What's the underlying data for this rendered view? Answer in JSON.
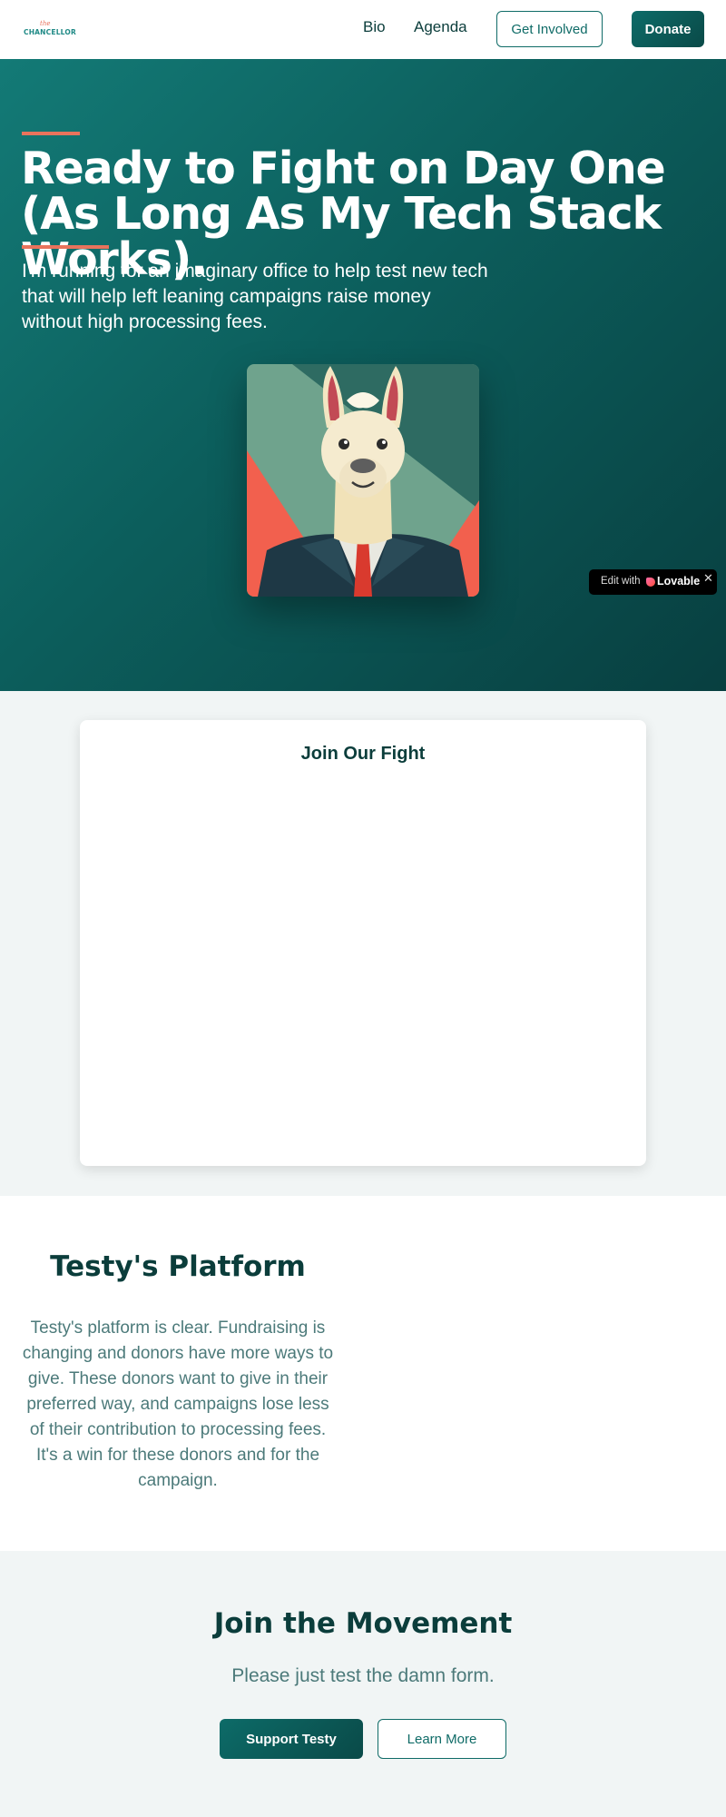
{
  "nav": {
    "logo_script": "the",
    "logo_word": "CHANCELLOR",
    "links": [
      "Bio",
      "Agenda"
    ],
    "get_involved": "Get Involved",
    "donate": "Donate"
  },
  "hero": {
    "title": "Ready to Fight on Day One (As Long As My Tech Stack Works).",
    "subtitle": "I'm running for an imaginary office to help test new tech that will help left leaning campaigns raise money without high processing fees.",
    "image_icon": "llama-in-suit-portrait"
  },
  "lovable_badge": {
    "edit": "Edit with",
    "brand": "Lovable",
    "close": "✕"
  },
  "join_fight": {
    "title": "Join Our Fight"
  },
  "platform": {
    "title": "Testy's Platform",
    "text": "Testy's platform is clear. Fundraising is changing and donors have more ways to give. These donors want to give in their preferred way, and campaigns lose less of their contribution to processing fees. It's a win for these donors and for the campaign."
  },
  "movement": {
    "title": "Join the Movement",
    "subtitle": "Please just test the damn form.",
    "support": "Support Testy",
    "learn_more": "Learn More"
  },
  "colors": {
    "primary": "#0f6b67",
    "dark": "#0b3d3b",
    "accent": "#e8735c",
    "muted_text": "#4c7a7a"
  }
}
